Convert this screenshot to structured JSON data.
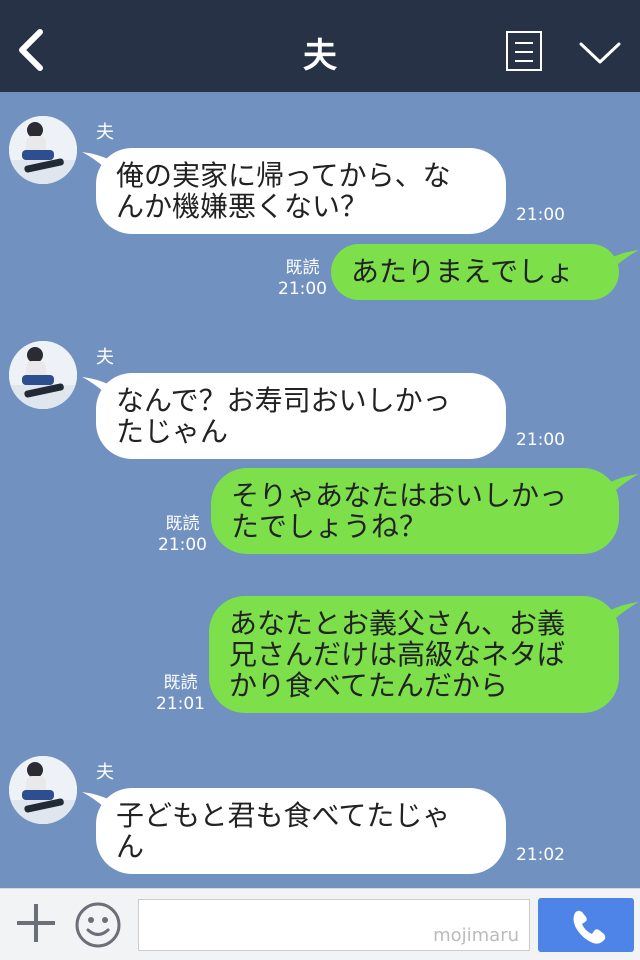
{
  "header": {
    "title": "夫",
    "icons": {
      "back": "chevron-left-icon",
      "notes": "notes-icon",
      "menu": "chevron-down-icon"
    }
  },
  "messages": [
    {
      "side": "in",
      "sender": "夫",
      "lines": [
        "俺の実家に帰ってから、な",
        "んか機嫌悪くない？"
      ],
      "time": "21:00"
    },
    {
      "side": "out",
      "lines": [
        "あたりまえでしょ"
      ],
      "read": "既読",
      "time": "21:00"
    },
    {
      "side": "in",
      "sender": "夫",
      "lines": [
        "なんで？お寿司おいしかっ",
        "たじゃん"
      ],
      "time": "21:00"
    },
    {
      "side": "out",
      "lines": [
        "そりゃあなたはおいしかっ",
        "たでしょうね？"
      ],
      "read": "既読",
      "time": "21:00"
    },
    {
      "side": "out",
      "lines": [
        "あなたとお義父さん、お義",
        "兄さんだけは高級なネタば",
        "かり食べてたんだから"
      ],
      "read": "既読",
      "time": "21:01"
    },
    {
      "side": "in",
      "sender": "夫",
      "lines": [
        "子どもと君も食べてたじゃ",
        "ん"
      ],
      "time": "21:02"
    }
  ],
  "input": {
    "watermark": "mojimaru"
  },
  "footer": {
    "icons": {
      "add": "plus-icon",
      "emoji": "smiley-icon",
      "call": "phone-icon"
    }
  },
  "colors": {
    "header": "#273246",
    "background": "#7191c1",
    "outgoing": "#7de04b",
    "incoming": "#ffffff",
    "call_button": "#4e84e8"
  }
}
